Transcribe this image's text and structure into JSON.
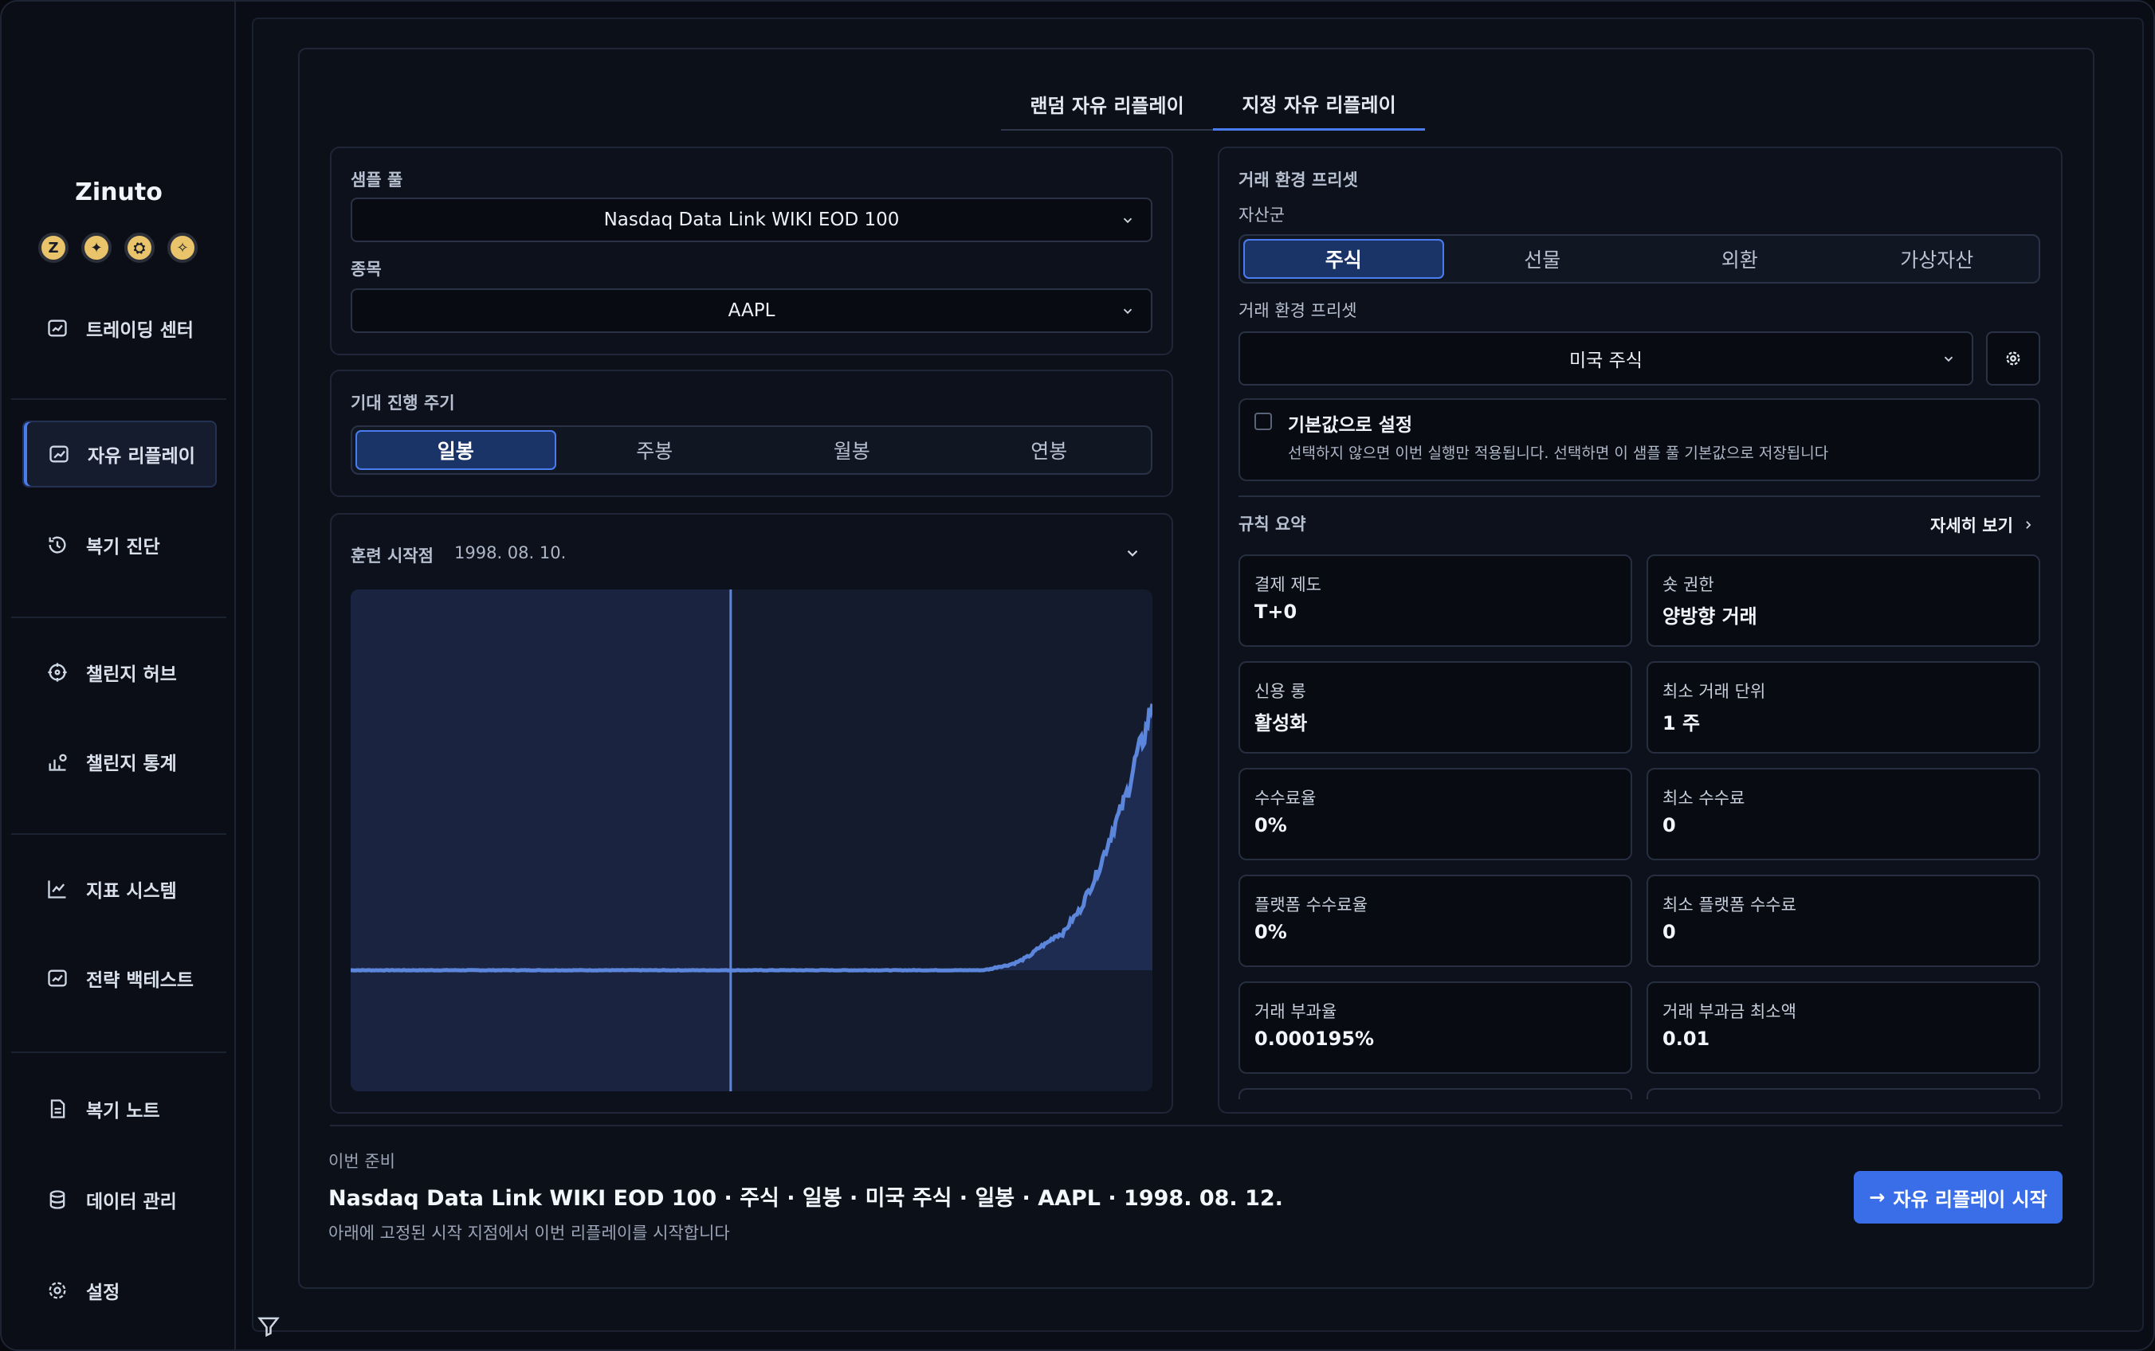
{
  "app": {
    "brand": "Zinuto",
    "badges": [
      "Z",
      "✦",
      "⛭",
      "✧"
    ]
  },
  "sidebar": {
    "items": [
      {
        "label": "트레이딩 센터",
        "icon": "chart-frame-icon"
      },
      {
        "label": "자유 리플레이",
        "icon": "trend-icon"
      },
      {
        "label": "복기 진단",
        "icon": "history-icon"
      },
      {
        "label": "챌린지 허브",
        "icon": "target-icon"
      },
      {
        "label": "챌린지 통계",
        "icon": "stats-user-icon"
      },
      {
        "label": "지표 시스템",
        "icon": "line-chart-icon"
      },
      {
        "label": "전략 백테스트",
        "icon": "chart-frame-icon"
      },
      {
        "label": "복기 노트",
        "icon": "document-icon"
      },
      {
        "label": "데이터 관리",
        "icon": "database-icon"
      },
      {
        "label": "설정",
        "icon": "gear-icon"
      }
    ]
  },
  "tabs": [
    "랜덤 자유 리플레이",
    "지정 자유 리플레이"
  ],
  "sample": {
    "pool_label": "샘플 풀",
    "pool_value": "Nasdaq Data Link WIKI EOD 100",
    "symbol_label": "종목",
    "symbol_value": "AAPL"
  },
  "period": {
    "label": "기대 진행 주기",
    "options": [
      "일봉",
      "주봉",
      "월봉",
      "연봉"
    ],
    "selected": "일봉"
  },
  "start": {
    "label": "훈련 시작점",
    "value": "1998. 08. 10."
  },
  "chart_data": {
    "type": "area",
    "x_start": "1980",
    "x_end": "2018",
    "marker_fraction": 0.474,
    "series": [
      {
        "values": [
          1,
          1,
          1,
          1,
          1,
          1,
          1,
          1,
          1,
          1,
          1,
          1,
          1,
          1,
          1,
          1,
          1,
          1,
          1,
          1,
          1,
          1,
          1,
          1,
          1,
          1,
          1,
          1,
          1,
          1,
          1,
          1,
          1,
          1,
          1,
          1,
          1,
          1,
          1,
          1,
          1,
          1,
          1,
          1,
          1,
          1,
          1,
          1,
          1,
          1,
          1,
          1,
          1,
          1,
          1,
          1,
          1,
          1,
          1,
          1,
          1,
          1,
          1,
          1,
          1,
          1,
          1,
          1,
          1,
          1,
          1,
          1,
          1,
          1,
          1,
          1,
          1,
          1,
          1,
          1.1,
          1.3,
          1.4,
          1.6,
          1.9,
          2.3,
          2.9,
          3.3,
          3.9,
          4.1,
          5.2,
          6.0,
          7.5,
          8.9,
          10.7,
          12.7,
          14.3,
          16.2,
          19.0,
          20.7,
          23.7
        ]
      }
    ]
  },
  "env": {
    "title": "거래 환경 프리셋",
    "asset_label": "자산군",
    "assets": [
      "주식",
      "선물",
      "외환",
      "가상자산"
    ],
    "asset_selected": "주식",
    "preset_label": "거래 환경 프리셋",
    "preset_value": "미국 주식"
  },
  "default": {
    "title": "기본값으로 설정",
    "desc": "선택하지 않으면 이번 실행만 적용됩니다. 선택하면 이 샘플 풀 기본값으로 저장됩니다"
  },
  "rules": {
    "title": "규칙 요약",
    "more": "자세히 보기",
    "items": [
      {
        "k": "결제 제도",
        "v": "T+0"
      },
      {
        "k": "숏 권한",
        "v": "양방향 거래"
      },
      {
        "k": "신용 롱",
        "v": "활성화"
      },
      {
        "k": "최소 거래 단위",
        "v": "1 주"
      },
      {
        "k": "수수료율",
        "v": "0%"
      },
      {
        "k": "최소 수수료",
        "v": "0"
      },
      {
        "k": "플랫폼 수수료율",
        "v": "0%"
      },
      {
        "k": "최소 플랫폼 수수료",
        "v": "0"
      },
      {
        "k": "거래 부과율",
        "v": "0.000195%"
      },
      {
        "k": "거래 부과금 최소액",
        "v": "0.01"
      }
    ]
  },
  "footer": {
    "label": "이번 준비",
    "summary": "Nasdaq Data Link WIKI EOD 100 · 주식 · 일봉 · 미국 주식 · 일봉 · AAPL · 1998. 08. 12.",
    "hint": "아래에 고정된 시작 지점에서 이번 리플레이를 시작합니다",
    "start_button": "자유 리플레이 시작"
  },
  "colors": {
    "accent": "#4a7cf0",
    "chart_line": "#5b86dc"
  }
}
